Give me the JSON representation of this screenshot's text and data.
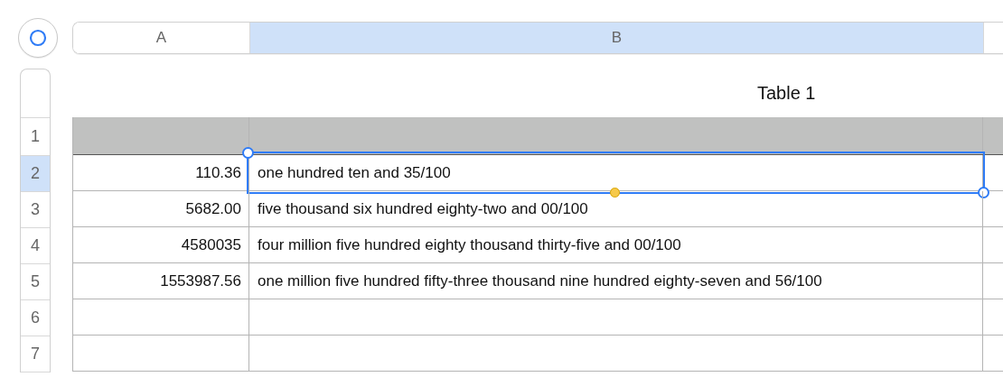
{
  "columns": [
    {
      "label": "A",
      "selected": false
    },
    {
      "label": "B",
      "selected": true
    }
  ],
  "table": {
    "title": "Table 1",
    "rows": [
      {
        "number": "1",
        "selected": false,
        "kind": "header"
      },
      {
        "number": "2",
        "selected": true,
        "kind": "body",
        "cells": [
          {
            "text": "110.36",
            "selected": false
          },
          {
            "text": "one hundred ten and 35/100",
            "selected": true
          }
        ]
      },
      {
        "number": "3",
        "selected": false,
        "kind": "body",
        "cells": [
          {
            "text": "5682.00",
            "selected": false
          },
          {
            "text": "five thousand six hundred eighty-two and 00/100",
            "selected": false
          }
        ]
      },
      {
        "number": "4",
        "selected": false,
        "kind": "body",
        "cells": [
          {
            "text": "4580035",
            "selected": false
          },
          {
            "text": "four million five hundred eighty thousand thirty-five and 00/100",
            "selected": false
          }
        ]
      },
      {
        "number": "5",
        "selected": false,
        "kind": "body",
        "cells": [
          {
            "text": "1553987.56",
            "selected": false
          },
          {
            "text": "one million five hundred fifty-three thousand nine hundred eighty-seven and 56/100",
            "selected": false
          }
        ]
      },
      {
        "number": "6",
        "selected": false,
        "kind": "body"
      },
      {
        "number": "7",
        "selected": false,
        "kind": "body"
      }
    ]
  }
}
